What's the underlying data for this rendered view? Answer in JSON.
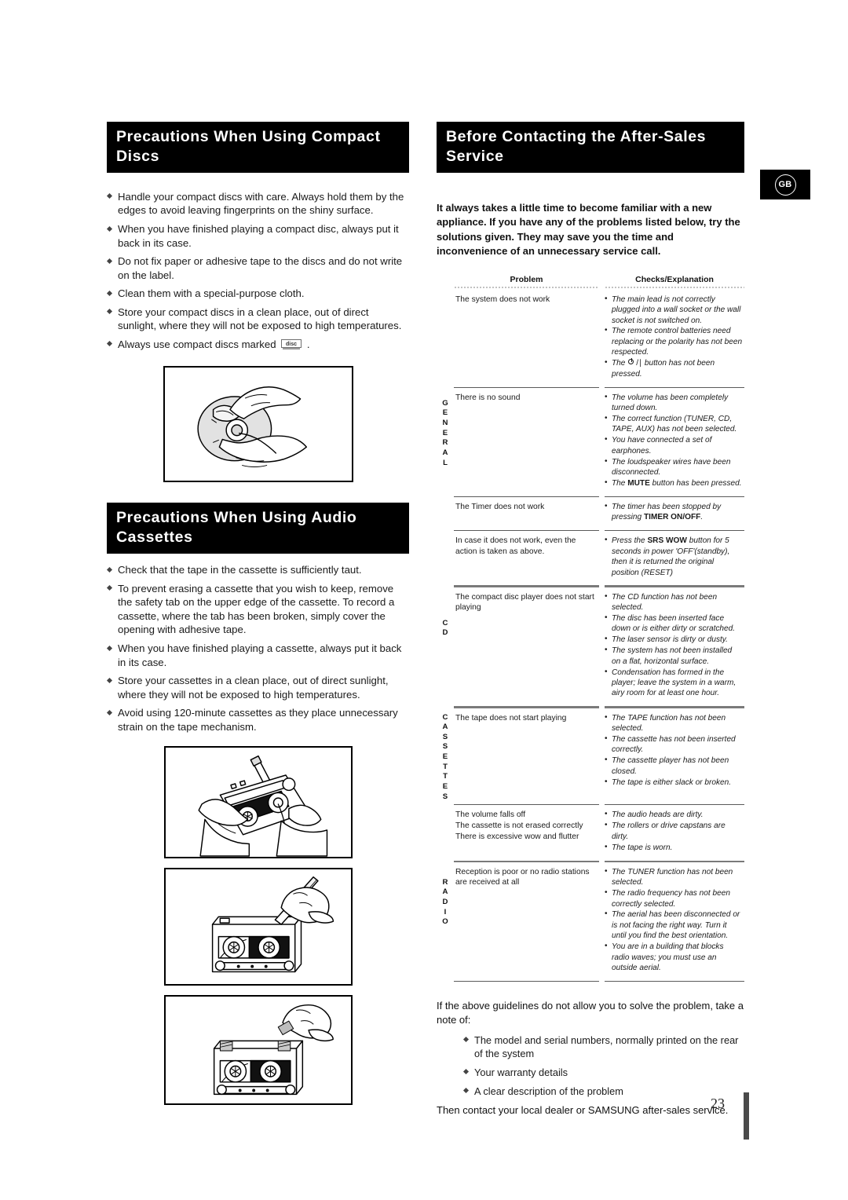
{
  "badge": {
    "label": "GB"
  },
  "page": {
    "number": "23"
  },
  "left": {
    "section_cd": {
      "title": "Precautions When Using Compact Discs",
      "bullets": [
        "Handle your compact discs with care. Always hold them by the edges to avoid leaving fingerprints on the shiny surface.",
        "When you have finished playing a compact disc, always put it back in its case.",
        "Do not fix paper or adhesive tape to the discs and do not write on the label.",
        "Clean them with a special-purpose cloth.",
        "Store your compact discs in a clean place, out of direct sunlight, where they will not be exposed to high temperatures."
      ],
      "last_bullet_prefix": "Always use compact discs marked",
      "last_bullet_suffix": ".",
      "disc_logo_text": "COMPACT disc DIGITAL AUDIO",
      "illustration": "hands-cleaning-compact-disc"
    },
    "section_cassette": {
      "title": "Precautions When Using Audio Cassettes",
      "bullets": [
        "Check that the tape in the cassette is sufficiently taut.",
        "To prevent erasing a cassette that you wish to keep, remove the safety tab on the upper edge of the cassette. To record a cassette, where  the tab has been broken, simply cover the opening with adhesive tape.",
        "When you have finished playing a cassette, always put it back in its case.",
        "Store your cassettes in a clean place, out of direct sunlight, where they will not be exposed to high temperatures.",
        "Avoid using 120-minute cassettes as they place unnecessary strain on the tape mechanism."
      ],
      "illustrations": [
        "tightening-cassette-tape-with-pencil",
        "removing-safety-tab-with-screwdriver",
        "covering-tab-opening-with-adhesive-tape"
      ]
    }
  },
  "right": {
    "title": "Before Contacting the After-Sales Service",
    "intro": "It always takes a little time to become familiar with a new appliance. If you have any of the problems listed below, try the solutions given. They may save you the time and inconvenience of an unnecessary service call.",
    "table": {
      "headers": {
        "problem": "Problem",
        "checks": "Checks/Explanation"
      },
      "rows": [
        {
          "section": "",
          "problem": "The system does not work",
          "checks": [
            "The main lead is not correctly plugged into a wall socket or the wall socket is not switched on.",
            "The remote control batteries need replacing or the polarity has not been respected.",
            "__PWR__ button has not been pressed."
          ]
        },
        {
          "section": "GENERAL",
          "problem": "There is no sound",
          "checks": [
            "The volume has been completely turned down.",
            "The correct function (TUNER, CD, TAPE, AUX) has not been selected.",
            "You have connected a set of earphones.",
            "The loudspeaker wires have been disconnected.",
            "__MUTE__"
          ]
        },
        {
          "section": "",
          "problem": "The Timer does not work",
          "checks": [
            "__TIMER__"
          ]
        },
        {
          "section": "",
          "problem": "In case it does not work, even the action is taken as above.",
          "checks": [
            "__SRS__"
          ]
        },
        {
          "section": "CD",
          "problem": "The compact disc player does not start playing",
          "checks": [
            "The CD function has not been selected.",
            "The disc has been inserted face down or is either dirty or scratched.",
            "The laser sensor is dirty or dusty.",
            "The system has not been installed on a flat, horizontal surface.",
            "Condensation has formed in the player; leave the system in a warm, airy room for at least one hour."
          ]
        },
        {
          "section": "CASSETTES",
          "problem": "The tape does not start playing",
          "checks": [
            "The TAPE function has not been selected.",
            "The cassette has not been inserted correctly.",
            "The cassette player has not been closed.",
            "The tape is either slack or broken."
          ]
        },
        {
          "section": "",
          "problem": "The volume falls off\nThe cassette is not erased correctly\nThere is excessive wow and flutter",
          "checks": [
            "The audio heads are dirty.",
            "The rollers or drive capstans are dirty.",
            "The tape is worn."
          ]
        },
        {
          "section": "RADIO",
          "problem": "Reception is poor or no radio stations are received at all",
          "checks": [
            "The TUNER function has not been selected.",
            "The radio frequency has not been correctly selected.",
            "The aerial has been disconnected or is not facing the right way. Turn it until you find the best orientation.",
            "You are in a building that blocks radio waves; you must use an outside aerial."
          ]
        }
      ],
      "inline_terms": {
        "pwr_prefix": "The",
        "pwr_suffix": "button has not been pressed.",
        "mute_prefix": "The",
        "mute_bold": "MUTE",
        "mute_suffix": "button has been pressed.",
        "timer_prefix": "The timer has been stopped by pressing",
        "timer_bold": "TIMER ON/OFF",
        "timer_suffix": ".",
        "srs_prefix": "Press the",
        "srs_bold": "SRS WOW",
        "srs_suffix": "button for 5 seconds in power 'OFF'(standby), then it is returned the original position (RESET)"
      }
    },
    "closing": {
      "lead": "If the above guidelines do not allow you to solve the problem, take a note of:",
      "bullets": [
        "The model and serial numbers, normally printed on the rear of the system",
        "Your warranty details",
        "A clear description of the problem"
      ],
      "tail": "Then contact your local dealer or SAMSUNG after-sales service."
    }
  }
}
